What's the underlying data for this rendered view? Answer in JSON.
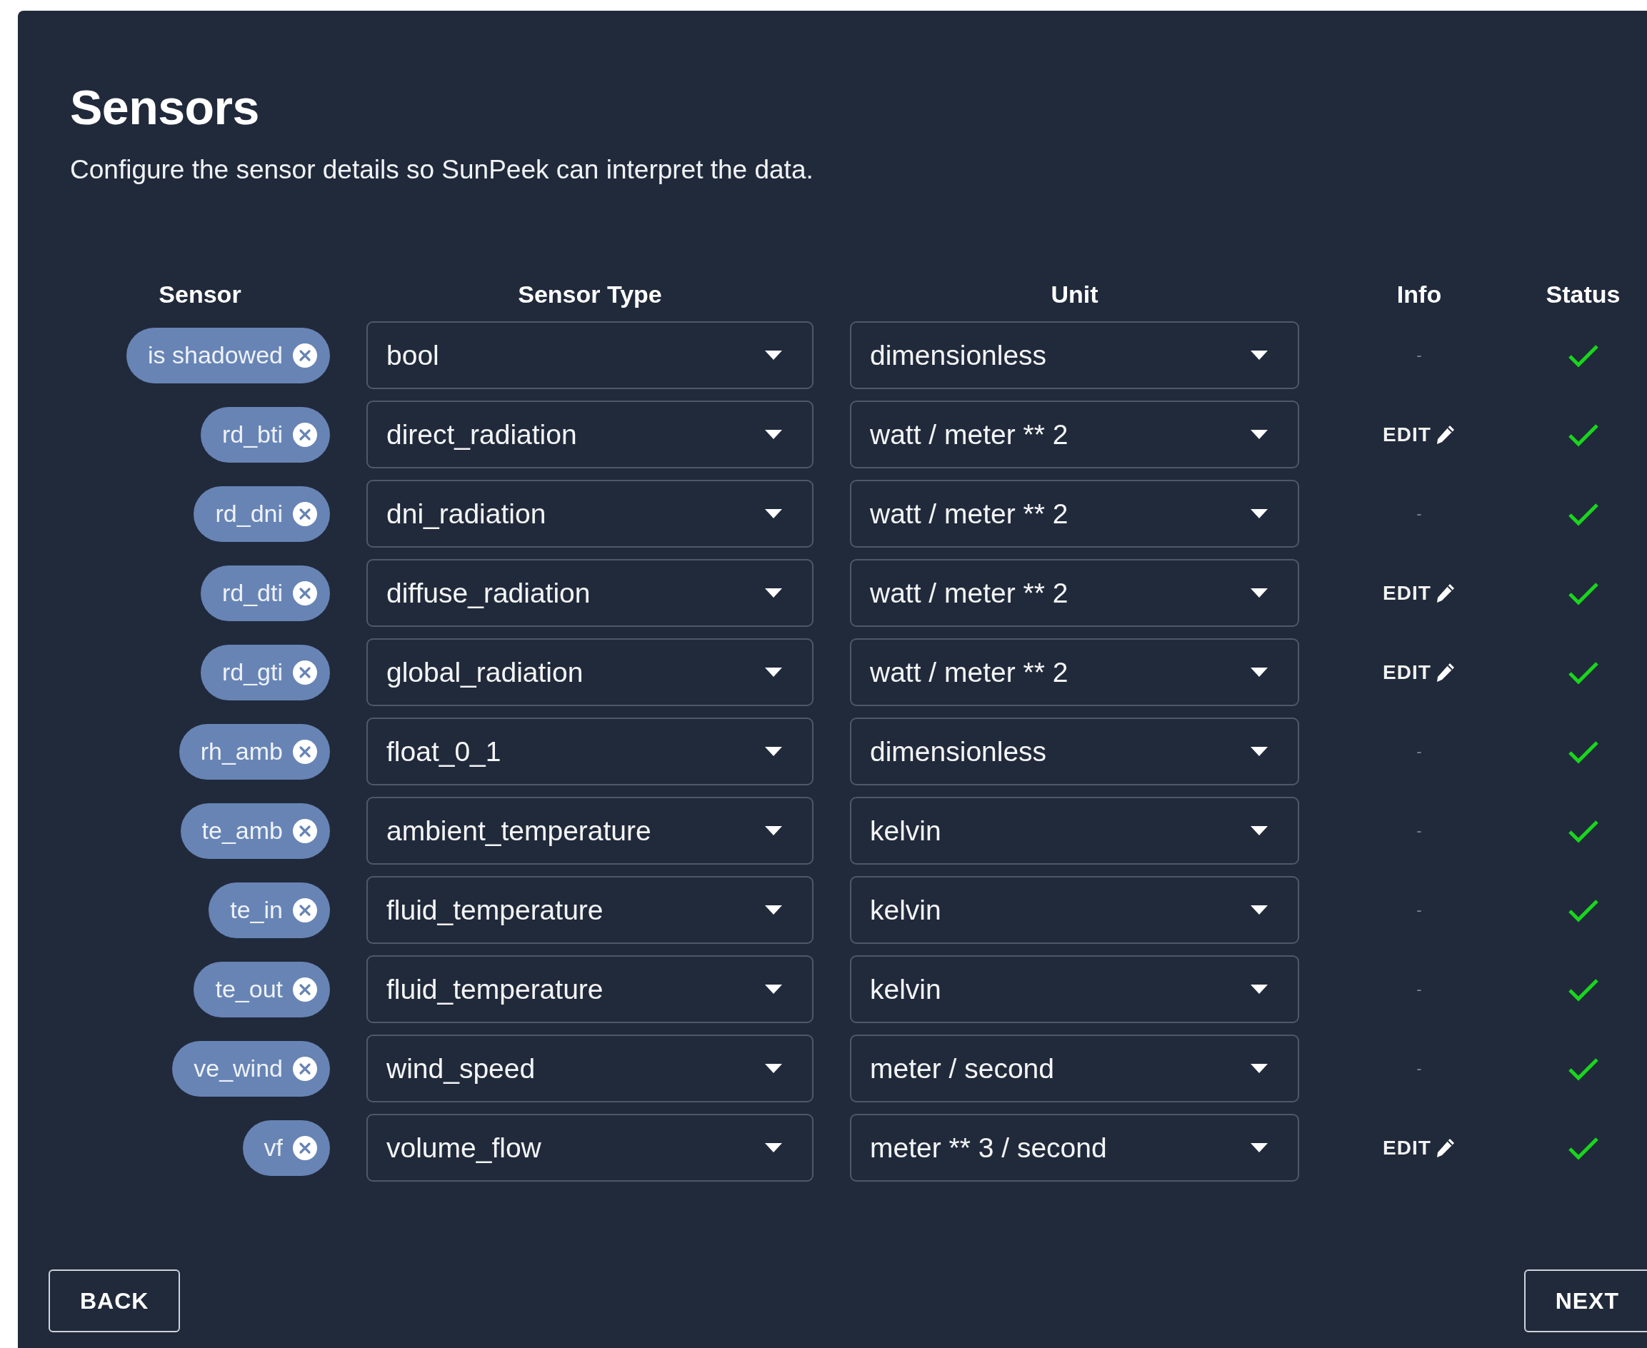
{
  "title": "Sensors",
  "subtitle": "Configure the sensor details so SunPeek can interpret the data.",
  "table": {
    "columns": [
      "Sensor",
      "Sensor Type",
      "Unit",
      "Info",
      "Status"
    ],
    "rows": [
      {
        "sensor": "is shadowed",
        "sensor_type": "bool",
        "unit": "dimensionless",
        "info": {
          "kind": "none",
          "label": "-"
        },
        "ok": true
      },
      {
        "sensor": "rd_bti",
        "sensor_type": "direct_radiation",
        "unit": "watt / meter ** 2",
        "info": {
          "kind": "edit",
          "label": "EDIT"
        },
        "ok": true
      },
      {
        "sensor": "rd_dni",
        "sensor_type": "dni_radiation",
        "unit": "watt / meter ** 2",
        "info": {
          "kind": "none",
          "label": "-"
        },
        "ok": true
      },
      {
        "sensor": "rd_dti",
        "sensor_type": "diffuse_radiation",
        "unit": "watt / meter ** 2",
        "info": {
          "kind": "edit",
          "label": "EDIT"
        },
        "ok": true
      },
      {
        "sensor": "rd_gti",
        "sensor_type": "global_radiation",
        "unit": "watt / meter ** 2",
        "info": {
          "kind": "edit",
          "label": "EDIT"
        },
        "ok": true
      },
      {
        "sensor": "rh_amb",
        "sensor_type": "float_0_1",
        "unit": "dimensionless",
        "info": {
          "kind": "none",
          "label": "-"
        },
        "ok": true
      },
      {
        "sensor": "te_amb",
        "sensor_type": "ambient_temperature",
        "unit": "kelvin",
        "info": {
          "kind": "none",
          "label": "-"
        },
        "ok": true
      },
      {
        "sensor": "te_in",
        "sensor_type": "fluid_temperature",
        "unit": "kelvin",
        "info": {
          "kind": "none",
          "label": "-"
        },
        "ok": true
      },
      {
        "sensor": "te_out",
        "sensor_type": "fluid_temperature",
        "unit": "kelvin",
        "info": {
          "kind": "none",
          "label": "-"
        },
        "ok": true
      },
      {
        "sensor": "ve_wind",
        "sensor_type": "wind_speed",
        "unit": "meter / second",
        "info": {
          "kind": "none",
          "label": "-"
        },
        "ok": true
      },
      {
        "sensor": "vf",
        "sensor_type": "volume_flow",
        "unit": "meter ** 3 / second",
        "info": {
          "kind": "edit",
          "label": "EDIT"
        },
        "ok": true
      }
    ]
  },
  "buttons": {
    "back": "BACK",
    "next": "NEXT"
  }
}
